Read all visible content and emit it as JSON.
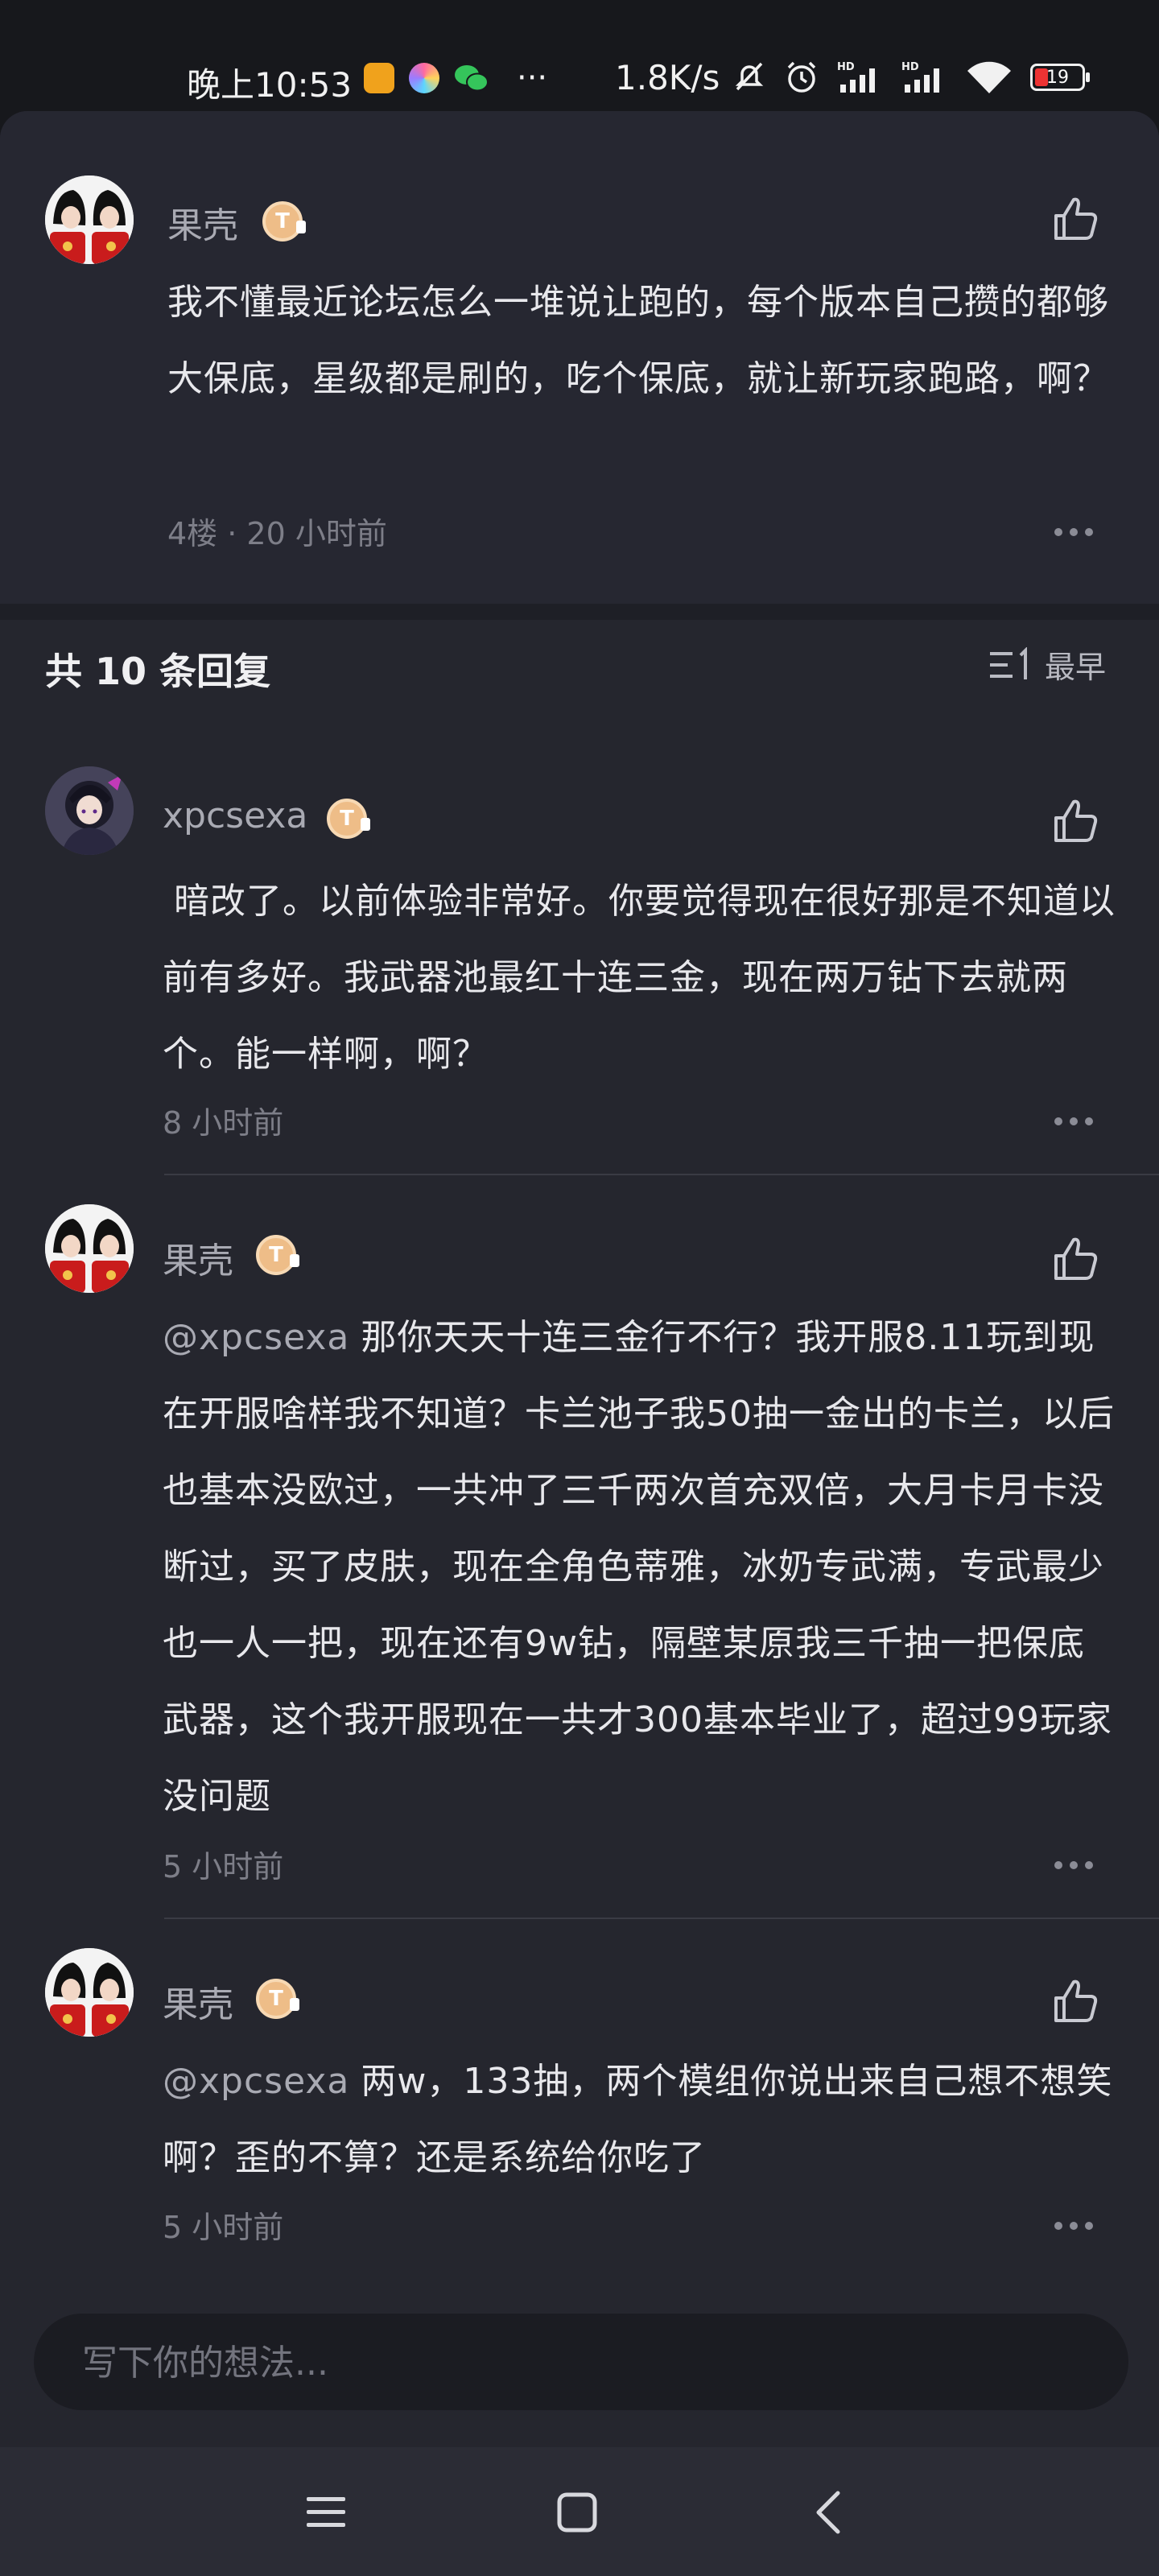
{
  "status_bar": {
    "time": "晚上10:53",
    "more": "···",
    "net_speed": "1.8K/s",
    "battery": "19",
    "icons": [
      "app-icon-orange",
      "app-icon-colorful",
      "wechat-icon",
      "mute-bell-icon",
      "alarm-icon",
      "hd-signal-icon",
      "hd-signal-icon",
      "wifi-icon",
      "battery-icon"
    ]
  },
  "main_post": {
    "username": "果壳",
    "badge": "T",
    "text": "我不懂最近论坛怎么一堆说让跑的，每个版本自己攒的都够大保底，星级都是刷的，吃个保底，就让新玩家跑路，啊？",
    "meta": "4楼 · 20 小时前"
  },
  "replies_header": {
    "title": "共 10 条回复",
    "sort_label": "最早"
  },
  "replies": [
    {
      "username": "xpcsexa",
      "badge": "T",
      "mention": "",
      "text": "暗改了。以前体验非常好。你要觉得现在很好那是不知道以前有多好。我武器池最红十连三金，现在两万钻下去就两个。能一样啊，啊？",
      "time": "8 小时前"
    },
    {
      "username": "果壳",
      "badge": "T",
      "mention": "@xpcsexa",
      "text": "那你天天十连三金行不行？我开服8.11玩到现在开服啥样我不知道？卡兰池子我50抽一金出的卡兰，以后也基本没欧过，一共冲了三千两次首充双倍，大月卡月卡没断过，买了皮肤，现在全角色蒂雅，冰奶专武满，专武最少也一人一把，现在还有9w钻，隔壁某原我三千抽一把保底武器，这个我开服现在一共才300基本毕业了，超过99玩家没问题",
      "time": "5 小时前"
    },
    {
      "username": "果壳",
      "badge": "T",
      "mention": "@xpcsexa",
      "text": "两w，133抽，两个模组你说出来自己想不想笑啊？歪的不算？还是系统给你吃了",
      "time": "5 小时前"
    }
  ],
  "input": {
    "placeholder": "写下你的想法..."
  },
  "colors": {
    "sheet_bg": "#25262e",
    "badge": "#eebd88",
    "text": "#e8e8ec",
    "muted": "#7d7e88"
  }
}
